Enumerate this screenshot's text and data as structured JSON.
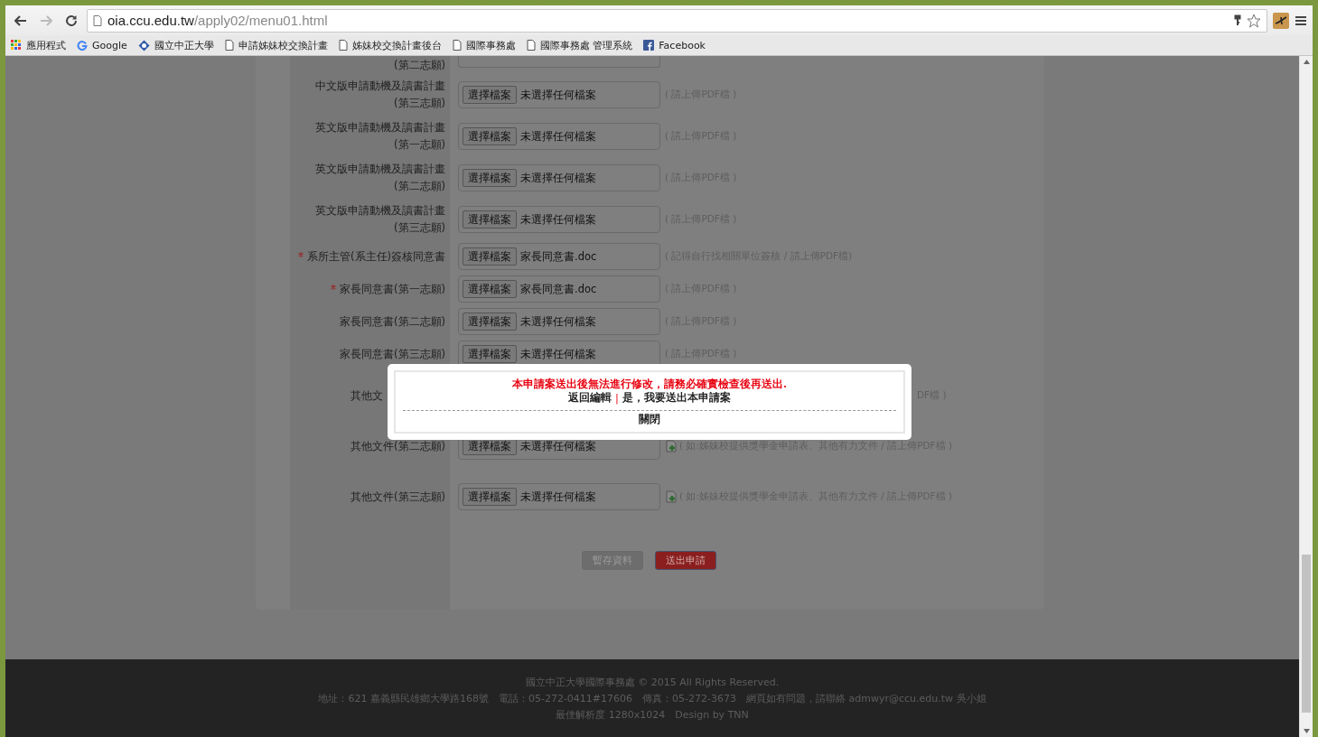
{
  "browser": {
    "url_host": "oia.ccu.edu.tw",
    "url_path": "/apply02/menu01.html",
    "bookmarks": [
      {
        "kind": "apps",
        "label": "應用程式"
      },
      {
        "kind": "google",
        "label": "Google"
      },
      {
        "kind": "school",
        "label": "國立中正大學"
      },
      {
        "kind": "page",
        "label": "申請姊妹校交換計畫"
      },
      {
        "kind": "page",
        "label": "姊妹校交換計畫後台"
      },
      {
        "kind": "page",
        "label": "國際事務處"
      },
      {
        "kind": "page",
        "label": "國際事務處 管理系統"
      },
      {
        "kind": "facebook",
        "label": "Facebook"
      }
    ]
  },
  "form": {
    "rows": [
      {
        "kind": "top",
        "label": "(第二志願)",
        "required": false
      },
      {
        "kind": "file",
        "label": "中文版申請動機及讀書計畫",
        "label2": "(第三志願)",
        "required": false,
        "button": "選擇檔案",
        "file": "未選擇任何檔案",
        "hint": "( 請上傳PDF檔 )"
      },
      {
        "kind": "file",
        "label": "英文版申請動機及讀書計畫",
        "label2": "(第一志願)",
        "required": false,
        "button": "選擇檔案",
        "file": "未選擇任何檔案",
        "hint": "( 請上傳PDF檔 )"
      },
      {
        "kind": "file",
        "label": "英文版申請動機及讀書計畫",
        "label2": "(第二志願)",
        "required": false,
        "button": "選擇檔案",
        "file": "未選擇任何檔案",
        "hint": "( 請上傳PDF檔 )"
      },
      {
        "kind": "file",
        "label": "英文版申請動機及讀書計畫",
        "label2": "(第三志願)",
        "required": false,
        "button": "選擇檔案",
        "file": "未選擇任何檔案",
        "hint": "( 請上傳PDF檔 )"
      },
      {
        "kind": "file",
        "label": "系所主管(系主任)簽核同意書",
        "required": true,
        "button": "選擇檔案",
        "file": "家長同意書.doc",
        "hint": "( 記得自行找相關單位簽核 / 請上傳PDF檔)"
      },
      {
        "kind": "file",
        "label": "家長同意書(第一志願)",
        "required": true,
        "button": "選擇檔案",
        "file": "家長同意書.doc",
        "hint": "( 請上傳PDF檔 )"
      },
      {
        "kind": "file",
        "label": "家長同意書(第二志願)",
        "required": false,
        "button": "選擇檔案",
        "file": "未選擇任何檔案",
        "hint": "( 請上傳PDF檔 )"
      },
      {
        "kind": "file",
        "label": "家長同意書(第三志願)",
        "required": false,
        "button": "選擇檔案",
        "file": "未選擇任何檔案",
        "hint": "( 請上傳PDF檔 )"
      },
      {
        "kind": "covered",
        "label": "其他文",
        "required": false,
        "hint": "DF檔 )"
      },
      {
        "kind": "add",
        "label": "其他文件(第二志願)",
        "required": false,
        "button": "選擇檔案",
        "file": "未選擇任何檔案",
        "hint": "( 如:姊妹校提供獎學金申請表、其他有力文件 / 請上傳PDF檔 )"
      },
      {
        "kind": "add",
        "label": "其他文件(第三志願)",
        "required": false,
        "button": "選擇檔案",
        "file": "未選擇任何檔案",
        "hint": "( 如:姊妹校提供獎學金申請表、其他有力文件 / 請上傳PDF檔 )"
      }
    ],
    "buttons": [
      {
        "kind": "save",
        "label": "暫存資料"
      },
      {
        "kind": "submit",
        "label": "送出申請"
      }
    ]
  },
  "modal": {
    "warning": "本申請案送出後無法進行修改，請務必確實檢查後再送出.",
    "back": "返回編輯",
    "separator": "|",
    "confirm": "是，我要送出本申請案",
    "close": "關閉"
  },
  "footer": {
    "lines": [
      "國立中正大學國際事務處 © 2015 All Rights Reserved.",
      "地址：621 嘉義縣民雄鄉大學路168號　電話：05-272-0411#17606　傳真：05-272-3673　網頁如有問題，請聯絡 admwyr@ccu.edu.tw 吳小姐",
      "最佳解析度 1280x1024　Design by TNN"
    ]
  }
}
